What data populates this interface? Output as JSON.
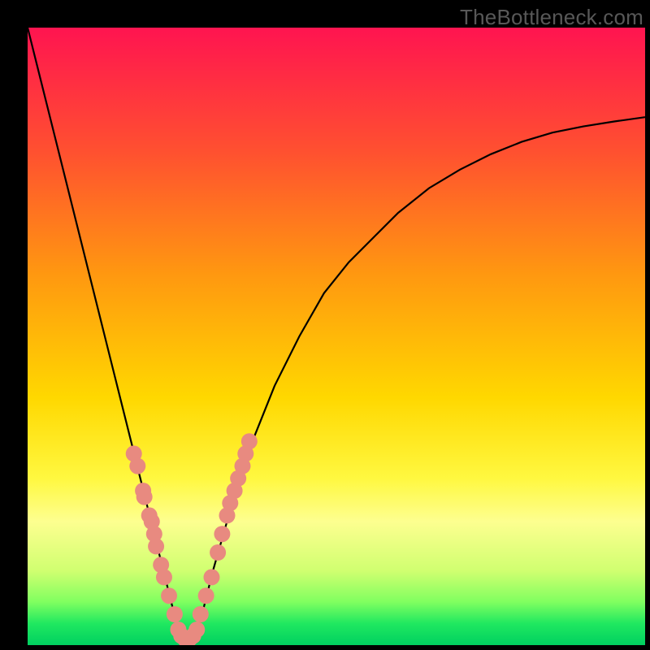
{
  "watermark": "TheBottleneck.com",
  "chart_data": {
    "type": "line",
    "title": "",
    "xlabel": "",
    "ylabel": "",
    "xlim": [
      0,
      100
    ],
    "ylim": [
      0,
      100
    ],
    "grid": false,
    "legend": false,
    "background_gradient_stops": [
      {
        "offset": 0.0,
        "color": "#ff1450"
      },
      {
        "offset": 0.2,
        "color": "#ff5030"
      },
      {
        "offset": 0.4,
        "color": "#ff9810"
      },
      {
        "offset": 0.6,
        "color": "#ffd800"
      },
      {
        "offset": 0.73,
        "color": "#fff840"
      },
      {
        "offset": 0.8,
        "color": "#fdff90"
      },
      {
        "offset": 0.88,
        "color": "#d0ff70"
      },
      {
        "offset": 0.93,
        "color": "#80ff60"
      },
      {
        "offset": 0.965,
        "color": "#20e860"
      },
      {
        "offset": 1.0,
        "color": "#00d060"
      }
    ],
    "series": [
      {
        "name": "bottleneck-curve",
        "color": "#000000",
        "x": [
          0,
          2,
          4,
          6,
          8,
          10,
          12,
          14,
          16,
          18,
          20,
          21,
          22,
          23,
          24,
          25,
          26,
          27,
          28,
          29,
          30,
          32,
          34,
          36,
          38,
          40,
          44,
          48,
          52,
          56,
          60,
          65,
          70,
          75,
          80,
          85,
          90,
          95,
          100
        ],
        "values": [
          100,
          92,
          84,
          76,
          68,
          60,
          52,
          44,
          36,
          28,
          20,
          16,
          12,
          8,
          4,
          1,
          0,
          1,
          4,
          8,
          12,
          19,
          26,
          32,
          37,
          42,
          50,
          57,
          62,
          66,
          70,
          74,
          77,
          79.5,
          81.5,
          83,
          84,
          84.8,
          85.5
        ]
      }
    ],
    "markers": {
      "name": "sample-points",
      "color": "#e88a80",
      "radius": 10,
      "points": [
        {
          "x": 17.2,
          "y": 31
        },
        {
          "x": 17.8,
          "y": 29
        },
        {
          "x": 18.7,
          "y": 25
        },
        {
          "x": 18.9,
          "y": 24
        },
        {
          "x": 19.7,
          "y": 21
        },
        {
          "x": 20.1,
          "y": 20
        },
        {
          "x": 20.5,
          "y": 18
        },
        {
          "x": 20.8,
          "y": 16
        },
        {
          "x": 21.6,
          "y": 13
        },
        {
          "x": 22.1,
          "y": 11
        },
        {
          "x": 22.9,
          "y": 8
        },
        {
          "x": 23.8,
          "y": 5
        },
        {
          "x": 24.4,
          "y": 2.5
        },
        {
          "x": 24.9,
          "y": 1.5
        },
        {
          "x": 25.5,
          "y": 1.0
        },
        {
          "x": 26.2,
          "y": 1.0
        },
        {
          "x": 26.8,
          "y": 1.5
        },
        {
          "x": 27.4,
          "y": 2.5
        },
        {
          "x": 28.0,
          "y": 5
        },
        {
          "x": 28.9,
          "y": 8
        },
        {
          "x": 29.8,
          "y": 11
        },
        {
          "x": 30.8,
          "y": 15
        },
        {
          "x": 31.5,
          "y": 18
        },
        {
          "x": 32.3,
          "y": 21
        },
        {
          "x": 32.8,
          "y": 23
        },
        {
          "x": 33.5,
          "y": 25
        },
        {
          "x": 34.1,
          "y": 27
        },
        {
          "x": 34.8,
          "y": 29
        },
        {
          "x": 35.3,
          "y": 31
        },
        {
          "x": 35.9,
          "y": 33
        }
      ]
    }
  }
}
